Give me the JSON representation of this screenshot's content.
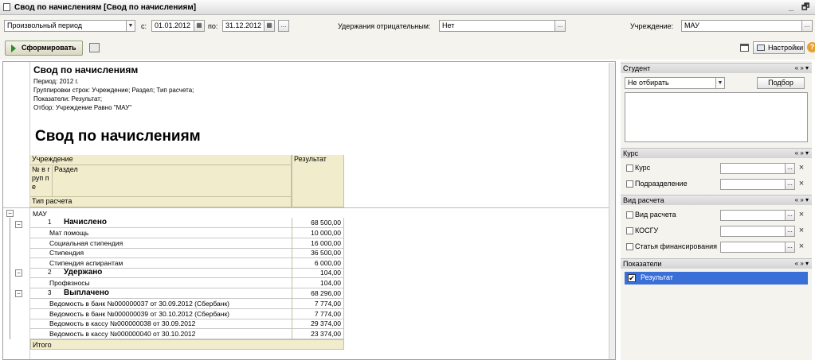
{
  "window": {
    "title": "Свод по начислениям [Свод по начислениям]",
    "minimize_glyph": "_",
    "restore_glyph": "🗗"
  },
  "filter": {
    "period_type": "Произвольный период",
    "from_label": "с:",
    "date_from": "01.01.2012",
    "to_label": "по:",
    "date_to": "31.12.2012",
    "dots": "...",
    "negative_label": "Удержания отрицательным:",
    "negative_value": "Нет",
    "institution_label": "Учреждение:",
    "institution_value": "МАУ"
  },
  "toolbar": {
    "run_label": "Сформировать",
    "settings_label": "Настройки",
    "help_glyph": "?"
  },
  "report": {
    "header_title": "Свод по начислениям",
    "meta": [
      "Период: 2012 г.",
      "Группировки строк: Учреждение; Раздел; Тип расчета;",
      "Показатели: Результат;",
      "Отбор: Учреждение Равно \"МАУ\""
    ],
    "big_title": "Свод по начислениям",
    "columns": {
      "institution": "Учреждение",
      "result": "Результат",
      "group_no": "№ в груп пе",
      "section": "Раздел",
      "calc_type": "Тип расчета"
    },
    "org": "МАУ",
    "rows": [
      {
        "no": "1",
        "name": "Начислено",
        "value": "68 500,00",
        "kind": "group"
      },
      {
        "name": "Мат помощь",
        "value": "10 000,00",
        "kind": "item"
      },
      {
        "name": "Социальная стипендия",
        "value": "16 000,00",
        "kind": "item"
      },
      {
        "name": "Стипендия",
        "value": "36 500,00",
        "kind": "item"
      },
      {
        "name": "Стипендия аспирантам",
        "value": "6 000,00",
        "kind": "item"
      },
      {
        "no": "2",
        "name": "Удержано",
        "value": "104,00",
        "kind": "group"
      },
      {
        "name": "Профвзносы",
        "value": "104,00",
        "kind": "item"
      },
      {
        "no": "3",
        "name": "Выплачено",
        "value": "68 296,00",
        "kind": "group"
      },
      {
        "name": "Ведомость в банк №000000037 от 30.09.2012 (Сбербанк)",
        "value": "7 774,00",
        "kind": "item"
      },
      {
        "name": "Ведомость в банк №000000039 от 30.10.2012 (Сбербанк)",
        "value": "7 774,00",
        "kind": "item"
      },
      {
        "name": "Ведомость в кассу №000000038 от 30.09.2012",
        "value": "29 374,00",
        "kind": "item"
      },
      {
        "name": "Ведомость в кассу №000000040 от 30.10.2012",
        "value": "23 374,00",
        "kind": "item"
      }
    ],
    "total_label": "Итого"
  },
  "side": {
    "student": {
      "title": "Студент",
      "select_value": "Не отбирать",
      "pick_label": "Подбор"
    },
    "course": {
      "title": "Курс",
      "items": [
        "Курс",
        "Подразделение"
      ]
    },
    "calc": {
      "title": "Вид расчета",
      "items": [
        "Вид расчета",
        "КОСГУ",
        "Статья финансирования"
      ]
    },
    "indicators": {
      "title": "Показатели",
      "items": [
        "Результат"
      ]
    },
    "panel_arrows": "« » ▾",
    "clear_glyph": "×"
  },
  "colors": {
    "accent": "#3a6fd8",
    "header_bg": "#f1edcc"
  }
}
